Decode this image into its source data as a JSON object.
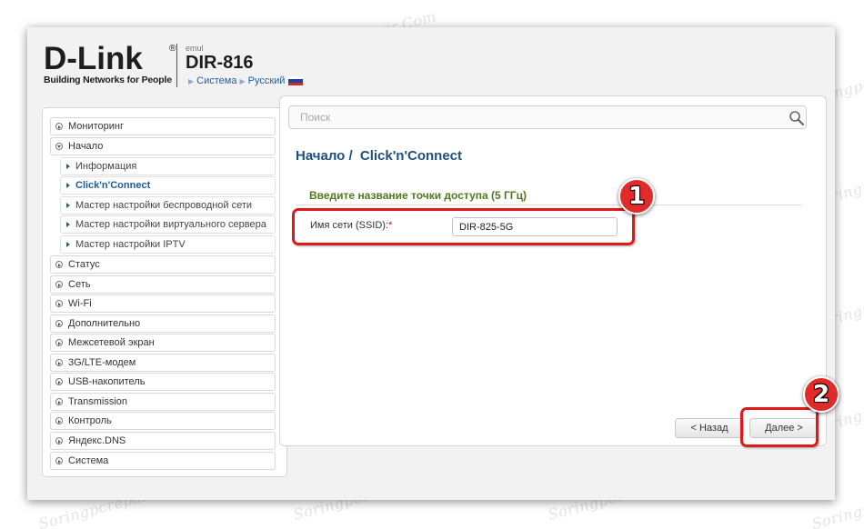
{
  "brand": {
    "logo_text": "D-Link",
    "tagline": "Building Networks for People",
    "reg_mark": "®"
  },
  "header": {
    "emul_label": "emul",
    "model": "DIR-816",
    "crumbs": [
      "Система",
      "Русский"
    ],
    "flag_colors": [
      "#ffffff",
      "#1c3fa8",
      "#d52b1e"
    ]
  },
  "sidebar": {
    "top": [
      {
        "label": "Мониторинг"
      },
      {
        "label": "Начало"
      }
    ],
    "sub": [
      {
        "label": "Информация"
      },
      {
        "label": "Click'n'Connect"
      },
      {
        "label": "Мастер настройки беспроводной сети"
      },
      {
        "label": "Мастер настройки виртуального сервера"
      },
      {
        "label": "Мастер настройки IPTV"
      }
    ],
    "rest": [
      {
        "label": "Статус"
      },
      {
        "label": "Сеть"
      },
      {
        "label": "Wi-Fi"
      },
      {
        "label": "Дополнительно"
      },
      {
        "label": "Межсетевой экран"
      },
      {
        "label": "3G/LTE-модем"
      },
      {
        "label": "USB-накопитель"
      },
      {
        "label": "Transmission"
      },
      {
        "label": "Контроль"
      },
      {
        "label": "Яндекс.DNS"
      },
      {
        "label": "Система"
      }
    ]
  },
  "search": {
    "placeholder": "Поиск"
  },
  "main": {
    "breadcrumb_parent": "Начало /",
    "breadcrumb_current": "Click'n'Connect",
    "section_title": "Введите название точки доступа (5 ГГц)",
    "ssid_label": "Имя сети (SSID):",
    "ssid_required_mark": "*",
    "ssid_value": "DIR-825-5G",
    "back_label": "< Назад",
    "next_label": "Далее >"
  },
  "callouts": {
    "badge_1": "1",
    "badge_2": "2",
    "color": "#e01818"
  },
  "watermark": {
    "text": "Soringpcrepair.Com"
  }
}
